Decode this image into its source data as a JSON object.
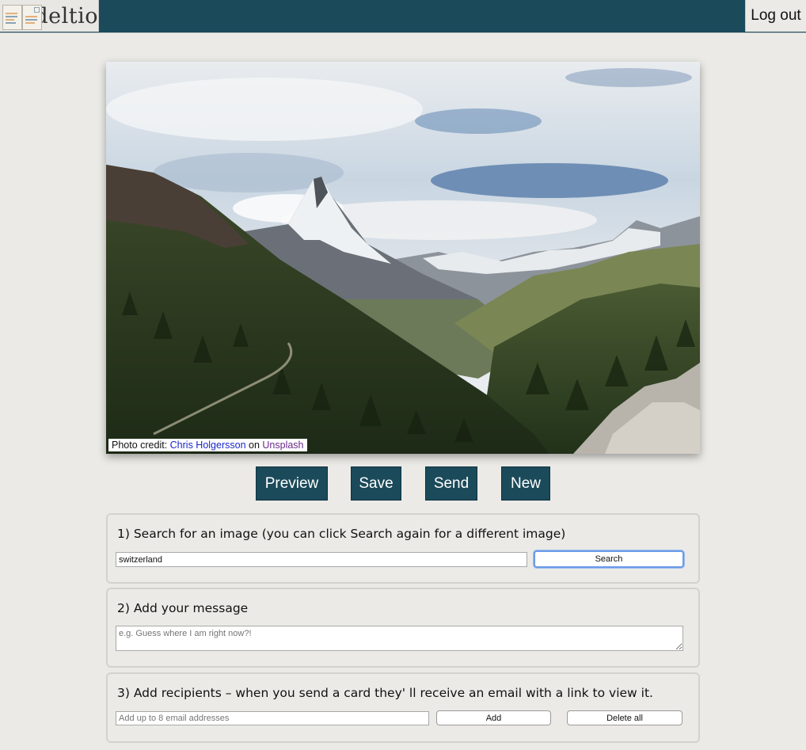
{
  "header": {
    "app_name": "deltio",
    "logout_label": "Log out"
  },
  "photo": {
    "credit_prefix": "Photo credit: ",
    "credit_author": "Chris Holgersson",
    "credit_middle": " on ",
    "credit_site": "Unsplash"
  },
  "actions": {
    "preview_label": "Preview",
    "save_label": "Save",
    "send_label": "Send",
    "new_label": "New"
  },
  "step1": {
    "title": "1) Search for an image (you can click Search again for a different image)",
    "search_value": "switzerland",
    "search_button": "Search"
  },
  "step2": {
    "title": "2) Add your message",
    "message_placeholder": "e.g. Guess where I am right now?!"
  },
  "step3": {
    "title": "3) Add recipients – when you send a card they' ll receive an email with a link to view it.",
    "recipients_placeholder": "Add up to 8 email addresses",
    "add_button": "Add",
    "delete_all_button": "Delete all"
  },
  "colors": {
    "brand": "#1b4a5a",
    "background": "#ebeae6",
    "credit_link": "#1a28c8",
    "credit_link_visited": "#6a2a8a"
  }
}
